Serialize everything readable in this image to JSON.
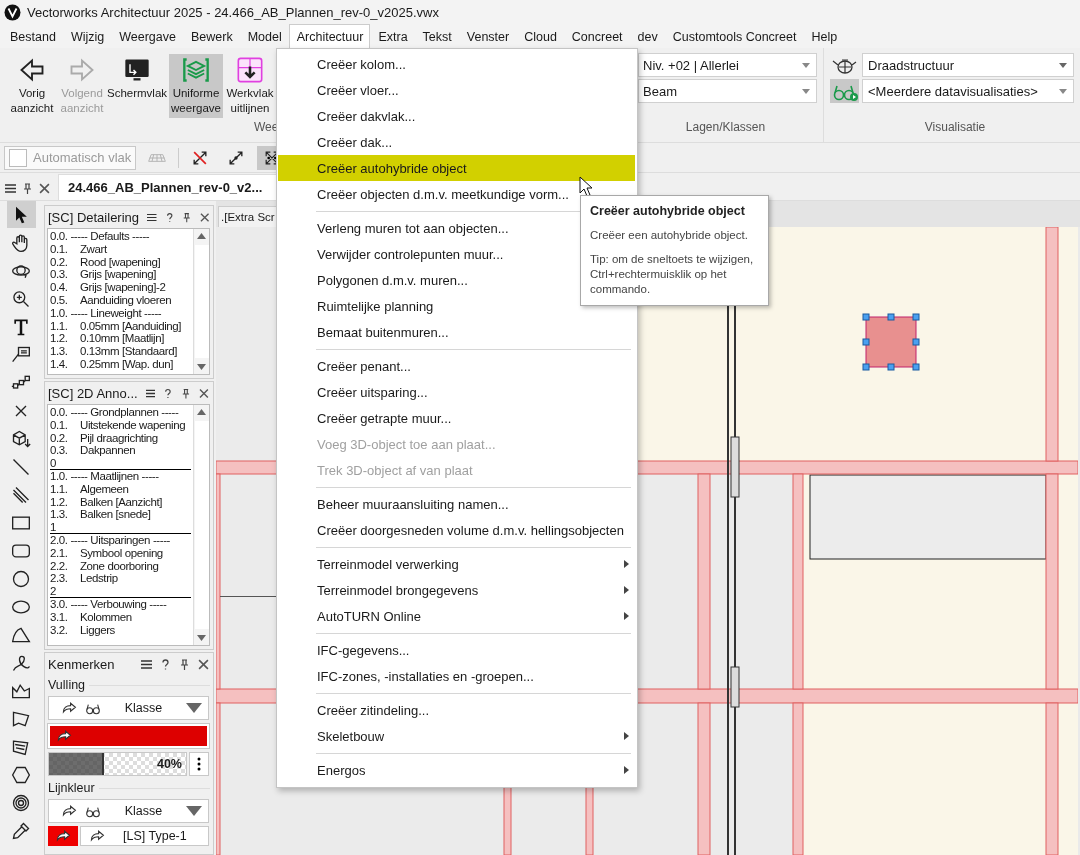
{
  "window": {
    "title": "Vectorworks Architectuur 2025 - 24.466_AB_Plannen_rev-0_v2025.vwx"
  },
  "menubar": [
    {
      "label": "Bestand",
      "selected": false
    },
    {
      "label": "Wijzig",
      "selected": false
    },
    {
      "label": "Weergave",
      "selected": false
    },
    {
      "label": "Bewerk",
      "selected": false
    },
    {
      "label": "Model",
      "selected": false
    },
    {
      "label": "Architectuur",
      "selected": true
    },
    {
      "label": "Extra",
      "selected": false
    },
    {
      "label": "Tekst",
      "selected": false
    },
    {
      "label": "Venster",
      "selected": false
    },
    {
      "label": "Cloud",
      "selected": false
    },
    {
      "label": "Concreet",
      "selected": false
    },
    {
      "label": "dev",
      "selected": false
    },
    {
      "label": "Customtools Concreet",
      "selected": false
    },
    {
      "label": "Help",
      "selected": false
    }
  ],
  "ribbon": {
    "view_group": {
      "label": "Wee",
      "buttons": [
        {
          "kind": "back",
          "label": "Vorig aanzicht",
          "disabled": false,
          "selected": false
        },
        {
          "kind": "forward",
          "label": "Volgend aanzicht",
          "disabled": true,
          "selected": false
        },
        {
          "kind": "screen",
          "label": "Schermvlak",
          "disabled": false,
          "selected": false
        },
        {
          "kind": "layers",
          "label": "Uniforme weergave",
          "disabled": false,
          "selected": true
        },
        {
          "kind": "plane",
          "label": "Werkvlak uitlijnen",
          "disabled": false,
          "selected": false
        }
      ]
    },
    "layers_group": {
      "label": "Lagen/Klassen",
      "layer": "Niv. +02 | Allerlei",
      "class": "Beam"
    },
    "visual_group": {
      "label": "Visualisatie",
      "render_mode": "Draadstructuur",
      "data_visualisation": "<Meerdere datavisualisaties>",
      "data_visualisation_on": true
    }
  },
  "toolbar": {
    "auto_plane": {
      "label": "Automatisch vlak",
      "checked": false,
      "disabled": true
    },
    "tools": [
      {
        "kind": "plane",
        "selected": false,
        "disabled": true
      },
      {
        "kind": "snap-off",
        "selected": false,
        "disabled": false
      },
      {
        "kind": "snap-two",
        "selected": false,
        "disabled": false
      },
      {
        "kind": "snap-four",
        "selected": true,
        "disabled": false
      }
    ]
  },
  "document_tabs": [
    {
      "label": "24.466_AB_Plannen_rev-0_v2...",
      "selected": true
    }
  ],
  "tool_palette": [
    {
      "kind": "arrow",
      "selected": true
    },
    {
      "kind": "hand",
      "selected": false
    },
    {
      "kind": "orbit",
      "selected": false
    },
    {
      "kind": "zoom",
      "selected": false
    },
    {
      "kind": "text",
      "selected": false
    },
    {
      "kind": "callout",
      "selected": false
    },
    {
      "kind": "chain",
      "selected": false
    },
    {
      "kind": "cross",
      "selected": false
    },
    {
      "kind": "cube",
      "selected": false
    },
    {
      "kind": "line",
      "selected": false
    },
    {
      "kind": "double-line",
      "selected": false
    },
    {
      "kind": "rect",
      "selected": false
    },
    {
      "kind": "rounded-rect",
      "selected": false
    },
    {
      "kind": "circle",
      "selected": false
    },
    {
      "kind": "oval",
      "selected": false
    },
    {
      "kind": "arc",
      "selected": false
    },
    {
      "kind": "freehand",
      "selected": false
    },
    {
      "kind": "polyline",
      "selected": false
    },
    {
      "kind": "polygon",
      "selected": false
    },
    {
      "kind": "stack",
      "selected": false
    },
    {
      "kind": "hexagon",
      "selected": false
    },
    {
      "kind": "spiral",
      "selected": false
    },
    {
      "kind": "eyedropper",
      "selected": false
    }
  ],
  "class_panels": [
    {
      "title": "[SC] Detailering",
      "rows": [
        {
          "kind": "header",
          "text": "0.0. ----- Defaults -----"
        },
        {
          "kind": "item",
          "number": "0.1.",
          "label": "Zwart"
        },
        {
          "kind": "item",
          "number": "0.2.",
          "label": "Rood [wapening]"
        },
        {
          "kind": "item",
          "number": "0.3.",
          "label": "Grijs [wapening]"
        },
        {
          "kind": "item",
          "number": "0.4.",
          "label": "Grijs [wapening]-2"
        },
        {
          "kind": "item",
          "number": "0.5.",
          "label": "Aanduiding vloeren"
        },
        {
          "kind": "header",
          "text": "1.0. ----- Lineweight -----"
        },
        {
          "kind": "item",
          "number": "1.1.",
          "label": "0.05mm [Aanduiding]"
        },
        {
          "kind": "item",
          "number": "1.2.",
          "label": "0.10mm [Maatlijn]"
        },
        {
          "kind": "item",
          "number": "1.3.",
          "label": "0.13mm [Standaard]"
        },
        {
          "kind": "item",
          "number": "1.4.",
          "label": "0.25mm [Wap. dun]"
        }
      ]
    },
    {
      "title": "[SC] 2D Anno...",
      "rows": [
        {
          "kind": "header",
          "text": "0.0. ----- Grondplannen -----"
        },
        {
          "kind": "item",
          "number": "0.1.",
          "label": "Uitstekende wapening"
        },
        {
          "kind": "item",
          "number": "0.2.",
          "label": "Pijl draagrichting"
        },
        {
          "kind": "item",
          "number": "0.3.",
          "label": "Dakpannen"
        },
        {
          "kind": "divider",
          "text": "0"
        },
        {
          "kind": "header",
          "text": "1.0. ----- Maatlijnen -----"
        },
        {
          "kind": "item",
          "number": "1.1.",
          "label": "Algemeen"
        },
        {
          "kind": "item",
          "number": "1.2.",
          "label": "Balken [Aanzicht]"
        },
        {
          "kind": "item",
          "number": "1.3.",
          "label": "Balken [snede]"
        },
        {
          "kind": "divider",
          "text": "1"
        },
        {
          "kind": "header",
          "text": "2.0. ----- Uitsparingen -----"
        },
        {
          "kind": "item",
          "number": "2.1.",
          "label": "Symbool opening"
        },
        {
          "kind": "item",
          "number": "2.2.",
          "label": "Zone doorboring"
        },
        {
          "kind": "item",
          "number": "2.3.",
          "label": "Ledstrip"
        },
        {
          "kind": "divider",
          "text": "2"
        },
        {
          "kind": "header",
          "text": "3.0. ----- Verbouwing -----"
        },
        {
          "kind": "item",
          "number": "3.1.",
          "label": "Kolommen"
        },
        {
          "kind": "item",
          "number": "3.2.",
          "label": "Liggers"
        }
      ]
    }
  ],
  "attributes": {
    "title": "Kenmerken",
    "fill": {
      "label": "Vulling",
      "source": "Klasse",
      "color": "#dd0000",
      "opacity": {
        "level": 0.4,
        "reading": "40%"
      }
    },
    "line": {
      "label": "Lijnkleur",
      "source": "Klasse",
      "color": "#ee0000",
      "style": "[LS] Type-1"
    }
  },
  "canvas": {
    "tab": ".[Extra Scr"
  },
  "context_menu": {
    "items": [
      {
        "kind": "item",
        "label": "Creëer kolom...",
        "disabled": false,
        "selected": false
      },
      {
        "kind": "item",
        "label": "Creëer vloer...",
        "disabled": false,
        "selected": false
      },
      {
        "kind": "item",
        "label": "Creëer dakvlak...",
        "disabled": false,
        "selected": false
      },
      {
        "kind": "item",
        "label": "Creëer dak...",
        "disabled": false,
        "selected": false
      },
      {
        "kind": "item",
        "label": "Creëer autohybride object",
        "disabled": false,
        "selected": true
      },
      {
        "kind": "item",
        "label": "Creëer objecten d.m.v. meetkundige vorm...",
        "disabled": false,
        "selected": false
      },
      {
        "kind": "separator"
      },
      {
        "kind": "item",
        "label": "Verleng muren tot aan objecten...",
        "disabled": false,
        "selected": false
      },
      {
        "kind": "item",
        "label": "Verwijder controlepunten muur...",
        "disabled": false,
        "selected": false
      },
      {
        "kind": "item",
        "label": "Polygonen d.m.v. muren...",
        "disabled": false,
        "selected": false
      },
      {
        "kind": "item",
        "label": "Ruimtelijke planning",
        "disabled": false,
        "selected": false
      },
      {
        "kind": "item",
        "label": "Bemaat buitenmuren...",
        "disabled": false,
        "selected": false
      },
      {
        "kind": "separator"
      },
      {
        "kind": "item",
        "label": "Creëer penant...",
        "disabled": false,
        "selected": false
      },
      {
        "kind": "item",
        "label": "Creëer uitsparing...",
        "disabled": false,
        "selected": false
      },
      {
        "kind": "item",
        "label": "Creëer getrapte muur...",
        "disabled": false,
        "selected": false
      },
      {
        "kind": "item",
        "label": "Voeg 3D-object toe aan plaat...",
        "disabled": true,
        "selected": false
      },
      {
        "kind": "item",
        "label": "Trek 3D-object af van plaat",
        "disabled": true,
        "selected": false
      },
      {
        "kind": "separator"
      },
      {
        "kind": "item",
        "label": "Beheer muuraansluiting namen...",
        "disabled": false,
        "selected": false
      },
      {
        "kind": "item",
        "label": "Creëer doorgesneden volume d.m.v. hellingsobjecten",
        "disabled": false,
        "selected": false
      },
      {
        "kind": "separator"
      },
      {
        "kind": "submenu",
        "label": "Terreinmodel verwerking",
        "disabled": false,
        "selected": false
      },
      {
        "kind": "submenu",
        "label": "Terreinmodel brongegevens",
        "disabled": false,
        "selected": false
      },
      {
        "kind": "submenu",
        "label": "AutoTURN Online",
        "disabled": false,
        "selected": false
      },
      {
        "kind": "separator"
      },
      {
        "kind": "item",
        "label": "IFC-gegevens...",
        "disabled": false,
        "selected": false
      },
      {
        "kind": "item",
        "label": "IFC-zones, -installaties en -groepen...",
        "disabled": false,
        "selected": false
      },
      {
        "kind": "separator"
      },
      {
        "kind": "item",
        "label": "Creëer zitindeling...",
        "disabled": false,
        "selected": false
      },
      {
        "kind": "submenu",
        "label": "Skeletbouw",
        "disabled": false,
        "selected": false
      },
      {
        "kind": "separator"
      },
      {
        "kind": "submenu",
        "label": "Energos",
        "disabled": false,
        "selected": false
      }
    ]
  },
  "tooltip": {
    "title": "Creëer autohybride object",
    "description": "Creëer een autohybride object.",
    "tip": "Tip: om de sneltoets te wijzigen, Ctrl+rechtermuisklik op het commando."
  }
}
